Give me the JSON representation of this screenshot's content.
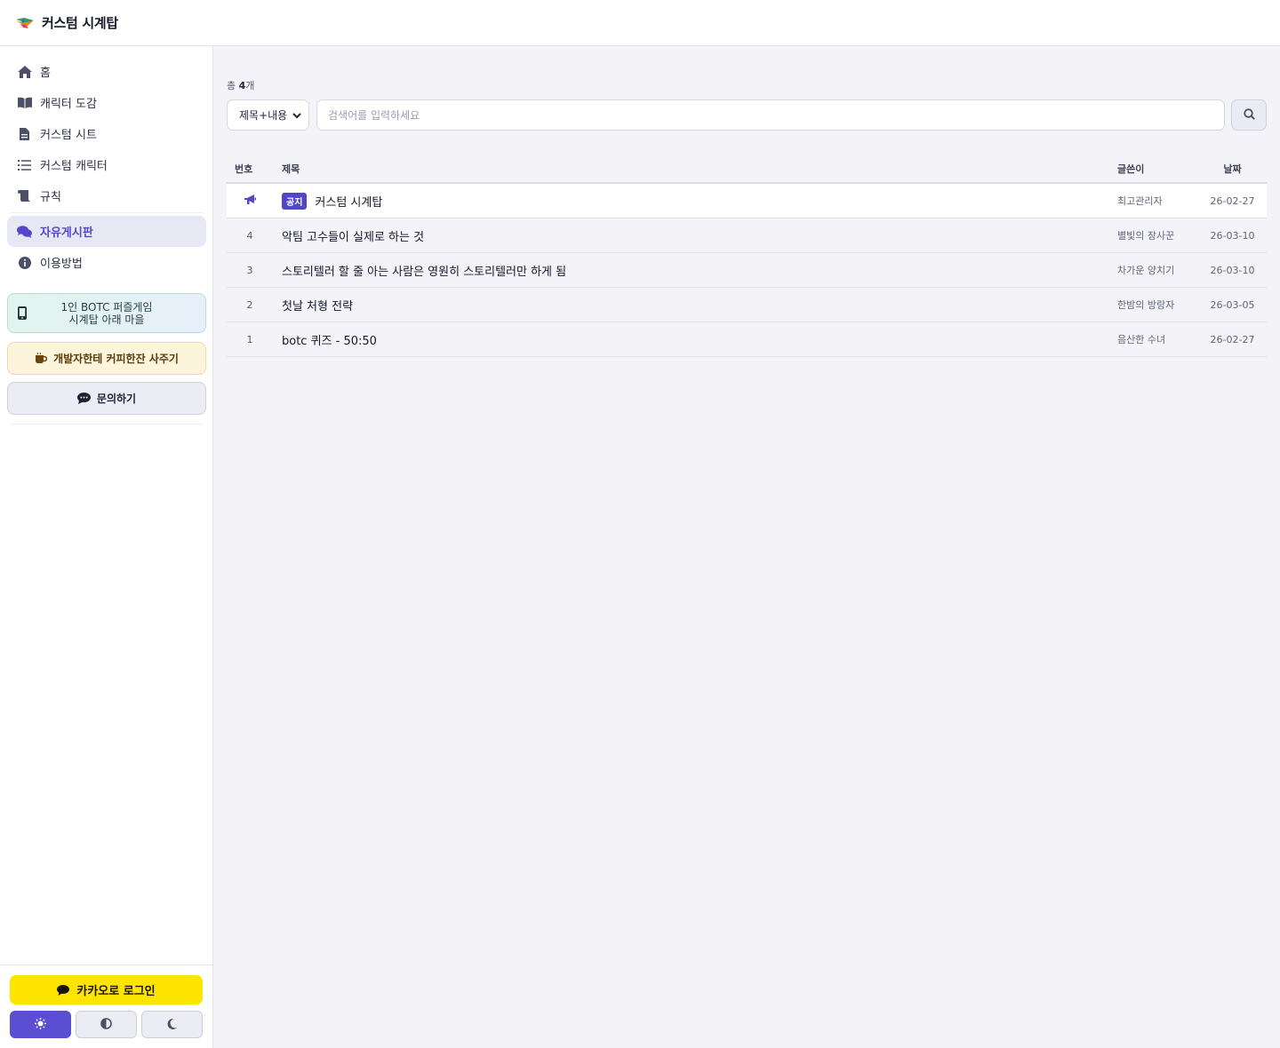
{
  "app": {
    "title": "커스텀 시계탑"
  },
  "sidebar": {
    "items": [
      {
        "label": "홈",
        "icon": "home-icon"
      },
      {
        "label": "캐릭터 도감",
        "icon": "book-icon"
      },
      {
        "label": "커스텀 시트",
        "icon": "file-icon"
      },
      {
        "label": "커스텀 캐릭터",
        "icon": "list-icon"
      },
      {
        "label": "규칙",
        "icon": "scroll-icon"
      }
    ],
    "items2": [
      {
        "label": "자유게시판",
        "icon": "comments-icon",
        "active": true
      },
      {
        "label": "이용방법",
        "icon": "info-icon"
      }
    ],
    "promo_botc": {
      "line1": "1인 BOTC 퍼즐게임",
      "line2": "시계탑 아래 마을"
    },
    "promo_coffee": "개발자한테 커피한잔 사주기",
    "promo_inquiry": "문의하기",
    "kakao_login": "카카오로 로그인",
    "theme_buttons": [
      "light-theme-icon",
      "auto-theme-icon",
      "dark-theme-icon"
    ]
  },
  "board": {
    "count_prefix": "총 ",
    "count_value": "4",
    "count_suffix": "개",
    "search": {
      "select_value": "제목+내용",
      "placeholder": "검색어를 입력하세요",
      "value": ""
    },
    "columns": {
      "num": "번호",
      "title": "제목",
      "author": "글쓴이",
      "date": "날짜"
    },
    "notice": {
      "badge": "공지",
      "title": "커스텀 시계탑",
      "author": "최고관리자",
      "date": "26-02-27"
    },
    "rows": [
      {
        "num": "4",
        "title": "악팀 고수들이 실제로 하는 것",
        "author": "별빛의 장사꾼",
        "date": "26-03-10"
      },
      {
        "num": "3",
        "title": "스토리텔러 할 줄 아는 사람은 영원히 스토리텔러만 하게 됨",
        "author": "차가운 양치기",
        "date": "26-03-10"
      },
      {
        "num": "2",
        "title": "첫날 처형 전략",
        "author": "한밤의 방랑자",
        "date": "26-03-05"
      },
      {
        "num": "1",
        "title": "botc 퀴즈 - 50:50",
        "author": "음산한 수녀",
        "date": "26-02-27"
      }
    ]
  },
  "colors": {
    "accent": "#5a4fd2",
    "kakao": "#fee500"
  }
}
